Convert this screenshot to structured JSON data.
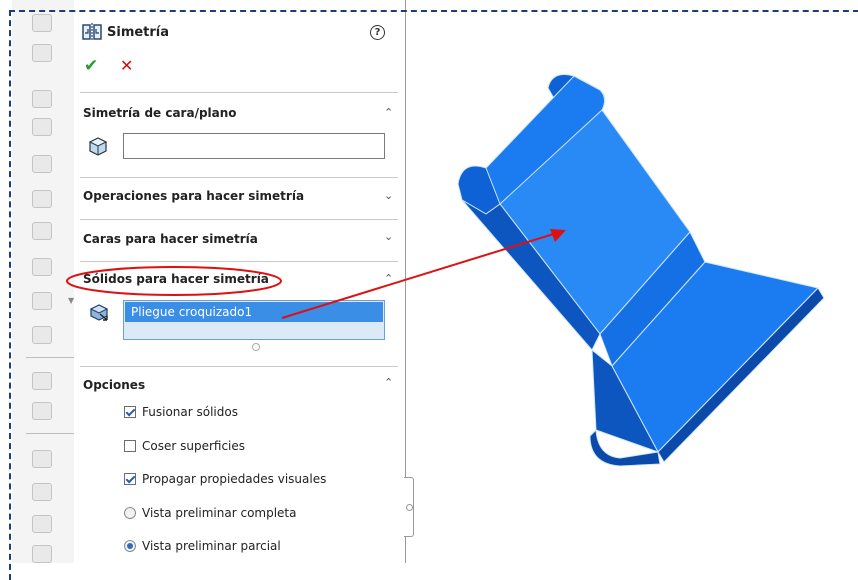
{
  "feature": {
    "title": "Simetría",
    "help_label": "?",
    "ok_glyph": "✔",
    "cancel_glyph": "✕"
  },
  "sections": {
    "mirror_face": {
      "label": "Simetría de cara/plano",
      "value": "",
      "expanded": true
    },
    "features_to_mirror": {
      "label": "Operaciones para hacer simetría",
      "expanded": false
    },
    "faces_to_mirror": {
      "label": "Caras para hacer simetría",
      "expanded": false
    },
    "bodies_to_mirror": {
      "label": "Sólidos para hacer simetría",
      "expanded": true,
      "items": [
        "Pliegue croquizado1"
      ]
    },
    "options": {
      "label": "Opciones",
      "expanded": true
    }
  },
  "options": {
    "merge_solids": {
      "label": "Fusionar sólidos",
      "checked": true
    },
    "knit_surfaces": {
      "label": "Coser superficies",
      "checked": false
    },
    "propagate_visual": {
      "label": "Propagar propiedades visuales",
      "checked": true
    },
    "full_preview": {
      "label": "Vista preliminar completa",
      "selected": false
    },
    "partial_preview": {
      "label": "Vista preliminar parcial",
      "selected": true
    }
  },
  "colors": {
    "model_blue": "#1a7cf0",
    "annotation_red": "#e01010",
    "selection_blue": "#3a8ee6"
  },
  "icons": [
    "mirror-feature-icon",
    "help-icon",
    "ok-check-icon",
    "cancel-x-icon",
    "face-plane-icon",
    "solid-body-icon",
    "chevron-up-icon",
    "chevron-down-icon"
  ]
}
